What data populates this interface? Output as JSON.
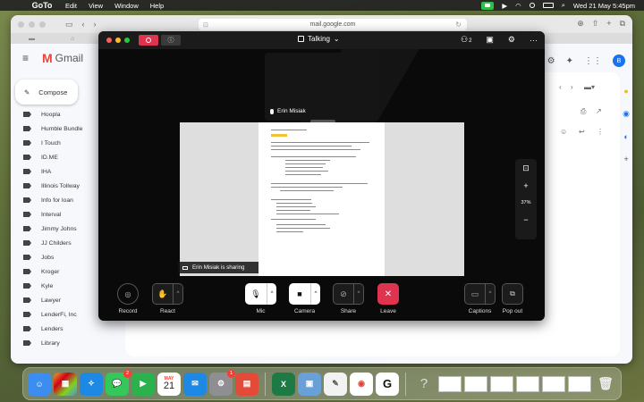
{
  "menubar": {
    "app_name": "GoTo",
    "menus": [
      "Edit",
      "View",
      "Window",
      "Help"
    ],
    "datetime": "Wed 21 May  5:45pm"
  },
  "browser": {
    "url": "mail.google.com"
  },
  "gmail": {
    "logo_text": "Gmail",
    "compose_label": "Compose",
    "labels": [
      "Hoopla",
      "Humble Bundle",
      "I Touch",
      "ID.ME",
      "IHA",
      "Illinois Tollway",
      "Info for loan",
      "Interval",
      "Jimmy Johns",
      "JJ Childers",
      "Jobs",
      "Kroger",
      "Kyle",
      "Lawyer",
      "LenderFi, Inc",
      "Lenders",
      "Library"
    ],
    "avatar_letter": "B"
  },
  "meet": {
    "title": "Talking",
    "participant_count": "2",
    "tile_name": "Erin Misiak",
    "sharing_text": "Erin Misiak is sharing",
    "zoom_level": "37%",
    "controls": {
      "record": "Record",
      "react": "React",
      "mic": "Mic",
      "camera": "Camera",
      "share": "Share",
      "leave": "Leave",
      "captions": "Captions",
      "popout": "Pop out"
    }
  },
  "dock": {
    "messages_badge": "2",
    "settings_badge": "1",
    "calendar_month": "MAY",
    "calendar_day": "21"
  }
}
